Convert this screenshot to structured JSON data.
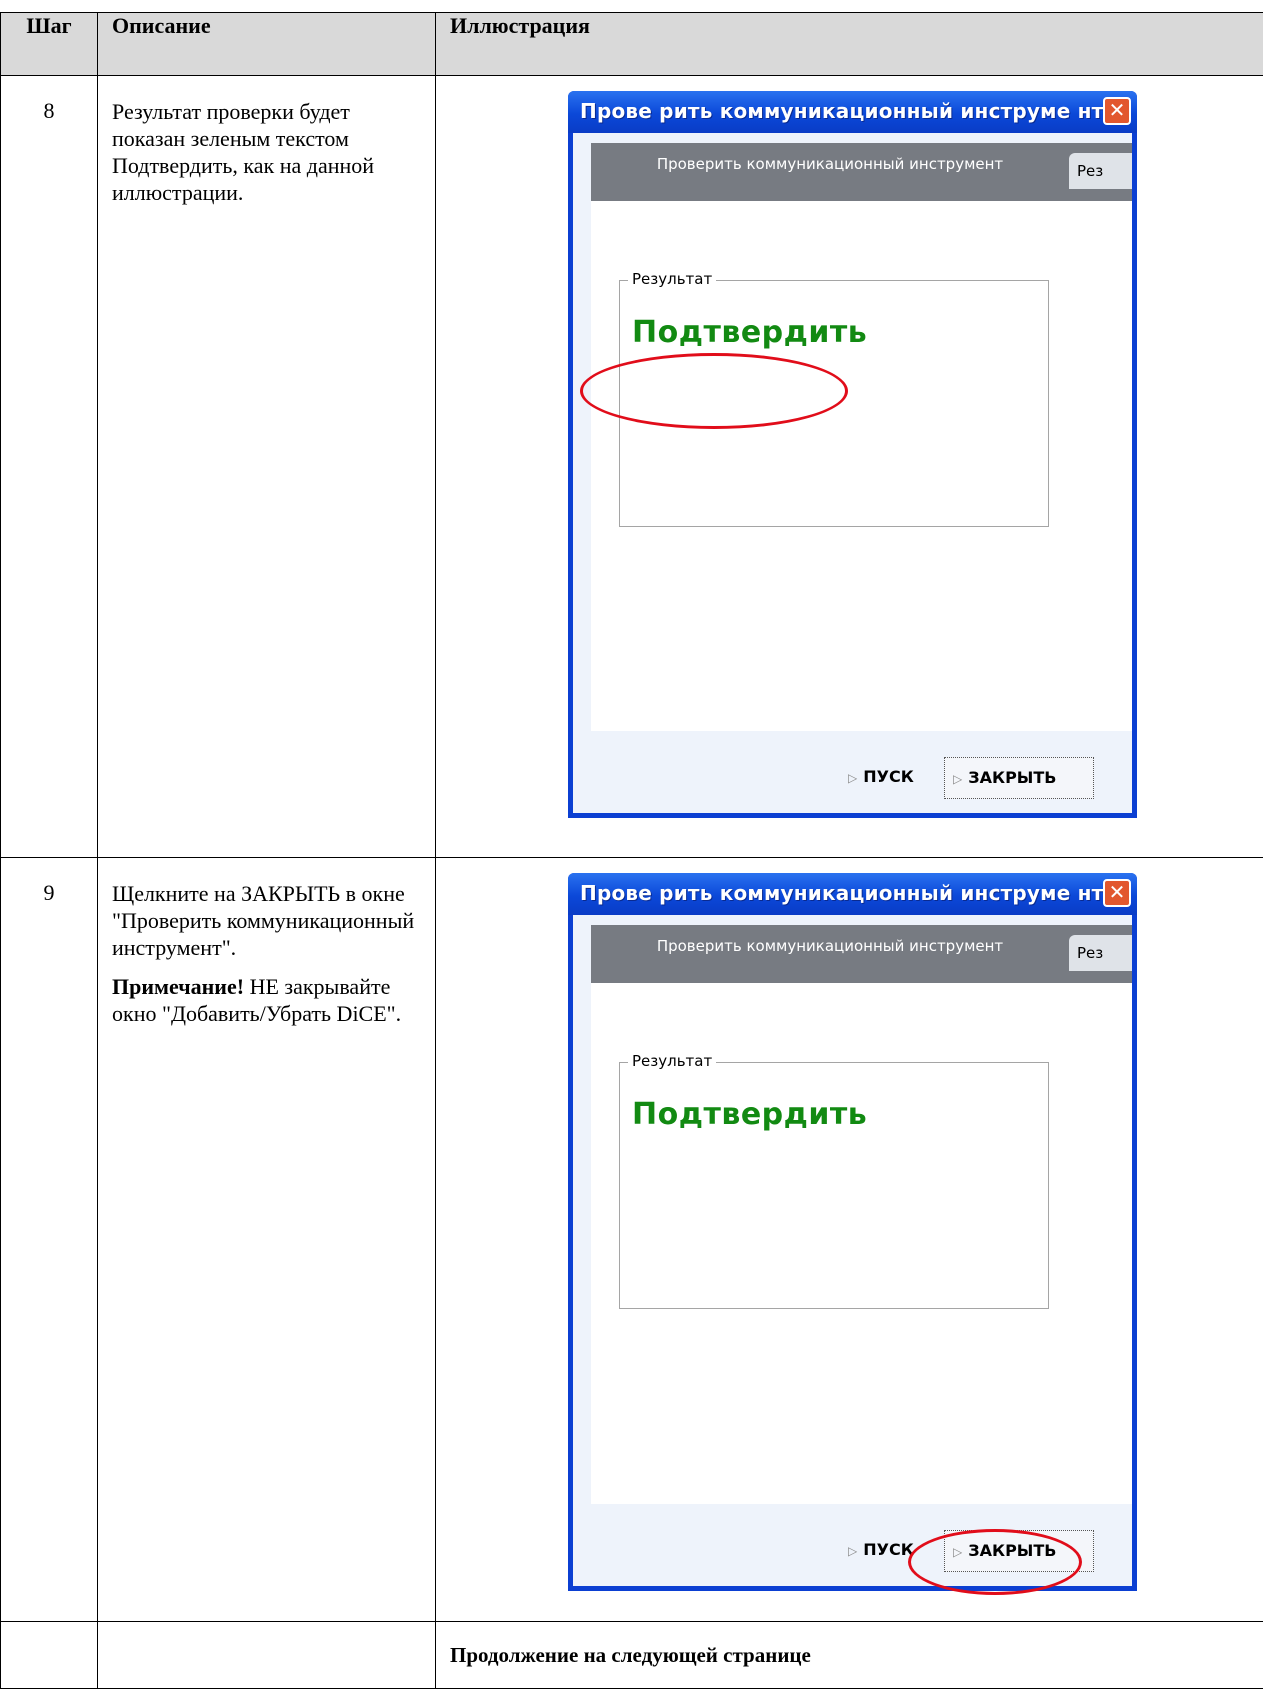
{
  "header": {
    "step": "Шаг",
    "description": "Описание",
    "illustration": "Иллюстрация"
  },
  "rows": [
    {
      "step": "8",
      "description": "Результат проверки будет показан зеленым текстом Подтвердить, как на данной иллюстрации."
    },
    {
      "step": "9",
      "description": "Щелкните на ЗАКРЫТЬ в окне \"Проверить коммуникационный инструмент\".",
      "note_label": "Примечание!",
      "note_text": " НЕ закрывайте окно \"Добавить/Убрать DiCE\"."
    }
  ],
  "window": {
    "title": "Прове рить коммуникационный инструме нт",
    "tab_active": "Проверить коммуникационный инструмент",
    "tab_next": "Рез",
    "group_label": "Результат",
    "result": "Подтвердить",
    "start_button": "ПУСК",
    "close_button": "ЗАКРЫТЬ",
    "close_icon": "close-x-icon",
    "button_arrow_icon": "arrow-right-icon",
    "result_color": "#128a12",
    "highlight_color": "#e10d1a",
    "titlebar_color": "#0b48d8"
  },
  "continuation": "Продолжение на следующей странице"
}
